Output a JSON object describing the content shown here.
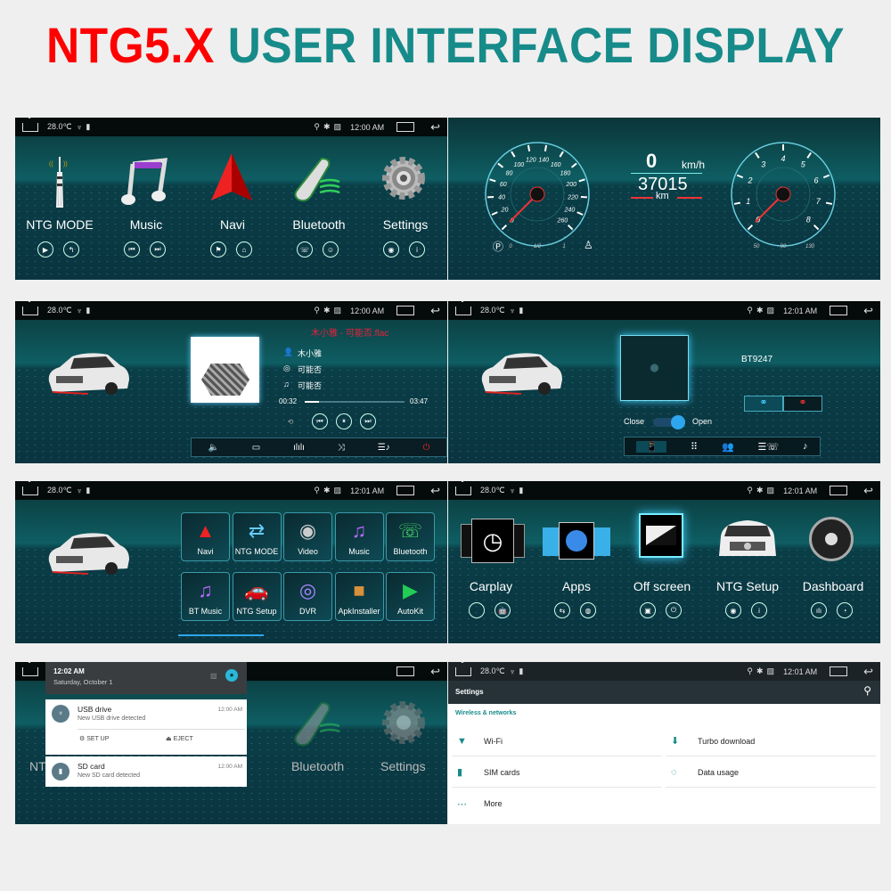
{
  "header": {
    "part1": "NTG5.X",
    "part2": "USER INTERFACE DISPLAY"
  },
  "status": {
    "temp": "28.0℃",
    "usb": "♆",
    "sd": "▮",
    "loc": "⚲",
    "bt": "✱",
    "nosim": "▨",
    "back": "↩",
    "time_a": "12:00 AM",
    "time_b": "12:01 AM"
  },
  "home1": {
    "items": [
      {
        "label": "NTG MODE",
        "icon": "antenna-tower",
        "b1": "▶",
        "b2": "↰"
      },
      {
        "label": "Music",
        "icon": "music-note",
        "b1": "⏮",
        "b2": "⏭"
      },
      {
        "label": "Navi",
        "icon": "navigation-arrow",
        "b1": "⚑",
        "b2": "⌂"
      },
      {
        "label": "Bluetooth",
        "icon": "phone-handset",
        "b1": "☏",
        "b2": "☺"
      },
      {
        "label": "Settings",
        "icon": "gear",
        "b1": "◉",
        "b2": "i"
      }
    ]
  },
  "dashboard": {
    "speed": "0",
    "speed_unit": "km/h",
    "odometer": "37015",
    "odo_unit": "km",
    "speed_ticks": [
      "0",
      "20",
      "40",
      "60",
      "80",
      "100",
      "120",
      "140",
      "160",
      "180",
      "200",
      "220",
      "240",
      "260"
    ],
    "rpm_ticks": [
      "0",
      "1",
      "2",
      "3",
      "4",
      "5",
      "6",
      "7",
      "8"
    ],
    "fuel_ticks": [
      "0",
      "1/2",
      "1"
    ],
    "temp_ticks": [
      "50",
      "90",
      "130"
    ],
    "speed_value": 0,
    "rpm_value": 0
  },
  "music": {
    "file": "木小雅 - 可能否.flac",
    "artist": "木小雅",
    "album": "可能否",
    "title": "可能否",
    "elapsed": "00:32",
    "total": "03:47",
    "progress": 0.14,
    "controls": [
      "⟲",
      "⏮",
      "⏸",
      "⏭"
    ],
    "bottom": [
      "🔈",
      "▭",
      "ılılı",
      "⤨",
      "☰♪",
      "⏻"
    ]
  },
  "bt": {
    "device": "BT9247",
    "close": "Close",
    "open": "Open",
    "toggle_on": true,
    "tabs": [
      "📱",
      "⠿",
      "👥",
      "☰☏",
      "♪"
    ]
  },
  "apps": {
    "row1": [
      {
        "label": "Navi",
        "icon": "▲"
      },
      {
        "label": "NTG MODE",
        "icon": "⇄"
      },
      {
        "label": "Video",
        "icon": "◉"
      },
      {
        "label": "Music",
        "icon": "♫"
      },
      {
        "label": "Bluetooth",
        "icon": "☏"
      }
    ],
    "row2": [
      {
        "label": "BT Music",
        "icon": "♫"
      },
      {
        "label": "NTG Setup",
        "icon": "🚗"
      },
      {
        "label": "DVR",
        "icon": "◎"
      },
      {
        "label": "ApkInstaller",
        "icon": "■"
      },
      {
        "label": "AutoKit",
        "icon": "▶"
      }
    ]
  },
  "home2": {
    "items": [
      {
        "label": "Carplay",
        "b1": "",
        "b2": "🤖"
      },
      {
        "label": "Apps",
        "b1": "⇆",
        "b2": "◍"
      },
      {
        "label": "Off screen",
        "b1": "▣",
        "b2": "⏻"
      },
      {
        "label": "NTG Setup",
        "b1": "◉",
        "b2": "i"
      },
      {
        "label": "Dashboard",
        "b1": "ılı",
        "b2": "◔"
      }
    ]
  },
  "notifications": {
    "time": "12:02 AM",
    "date": "Saturday, October 1",
    "items": [
      {
        "title": "USB drive",
        "text": "New USB drive detected",
        "time": "12:00 AM",
        "a1": "SET UP",
        "a2": "EJECT"
      },
      {
        "title": "SD card",
        "text": "New SD card detected",
        "time": "12:00 AM"
      }
    ],
    "bg_labels": [
      "NT",
      "Bluetooth",
      "Settings"
    ]
  },
  "settings": {
    "title": "Settings",
    "section": "Wireless & networks",
    "items": [
      {
        "label": "Wi-Fi",
        "icon": "wifi"
      },
      {
        "label": "Turbo download",
        "icon": "download"
      },
      {
        "label": "SIM cards",
        "icon": "sim"
      },
      {
        "label": "Data usage",
        "icon": "data"
      },
      {
        "label": "More",
        "icon": "more"
      }
    ],
    "accent": "#168b8a"
  }
}
